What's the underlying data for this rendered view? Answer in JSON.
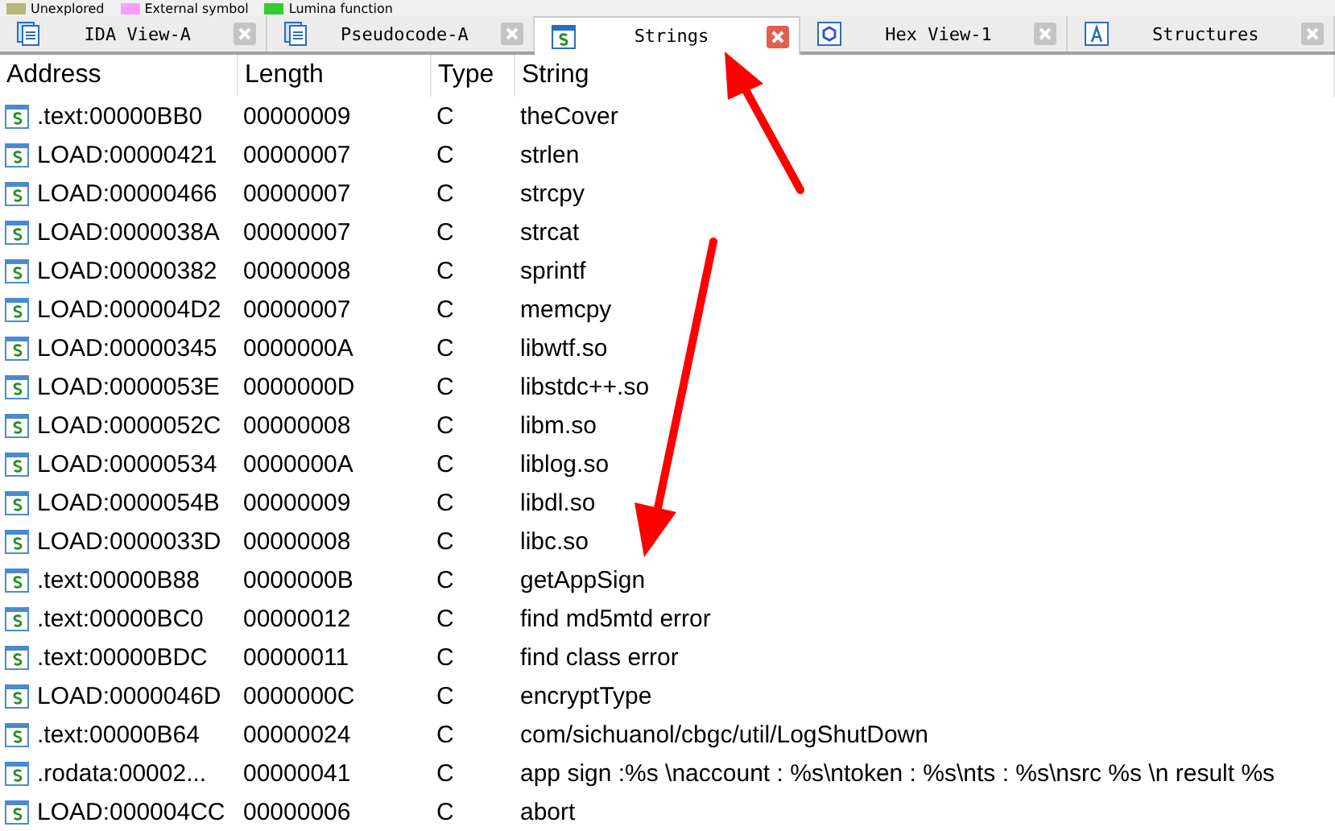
{
  "legend": [
    {
      "label": "Unexplored",
      "color": "#b8b87a"
    },
    {
      "label": "External symbol",
      "color": "#ff9cff"
    },
    {
      "label": "Lumina function",
      "color": "#33cc33"
    }
  ],
  "tabs": [
    {
      "label": "IDA View-A",
      "kind": "listing",
      "selected": false
    },
    {
      "label": "Pseudocode-A",
      "kind": "listing",
      "selected": false
    },
    {
      "label": "Strings",
      "kind": "strings",
      "selected": true
    },
    {
      "label": "Hex View-1",
      "kind": "hex",
      "selected": false
    },
    {
      "label": "Structures",
      "kind": "structs",
      "selected": false
    }
  ],
  "table": {
    "columns": [
      "Address",
      "Length",
      "Type",
      "String"
    ],
    "rows": [
      [
        ".text:00000BB0",
        "00000009",
        "C",
        "theCover"
      ],
      [
        "LOAD:00000421",
        "00000007",
        "C",
        "strlen"
      ],
      [
        "LOAD:00000466",
        "00000007",
        "C",
        "strcpy"
      ],
      [
        "LOAD:0000038A",
        "00000007",
        "C",
        "strcat"
      ],
      [
        "LOAD:00000382",
        "00000008",
        "C",
        "sprintf"
      ],
      [
        "LOAD:000004D2",
        "00000007",
        "C",
        "memcpy"
      ],
      [
        "LOAD:00000345",
        "0000000A",
        "C",
        "libwtf.so"
      ],
      [
        "LOAD:0000053E",
        "0000000D",
        "C",
        "libstdc++.so"
      ],
      [
        "LOAD:0000052C",
        "00000008",
        "C",
        "libm.so"
      ],
      [
        "LOAD:00000534",
        "0000000A",
        "C",
        "liblog.so"
      ],
      [
        "LOAD:0000054B",
        "00000009",
        "C",
        "libdl.so"
      ],
      [
        "LOAD:0000033D",
        "00000008",
        "C",
        "libc.so"
      ],
      [
        ".text:00000B88",
        "0000000B",
        "C",
        "getAppSign"
      ],
      [
        ".text:00000BC0",
        "00000012",
        "C",
        "find md5mtd error"
      ],
      [
        ".text:00000BDC",
        "00000011",
        "C",
        "find class error"
      ],
      [
        "LOAD:0000046D",
        "0000000C",
        "C",
        "encryptType"
      ],
      [
        ".text:00000B64",
        "00000024",
        "C",
        "com/sichuanol/cbgc/util/LogShutDown"
      ],
      [
        ".rodata:00002...",
        "00000041",
        "C",
        "app sign :%s \\naccount : %s\\ntoken : %s\\nts : %s\\nsrc %s \\n result %s"
      ],
      [
        "LOAD:000004CC",
        "00000006",
        "C",
        "abort"
      ]
    ]
  }
}
